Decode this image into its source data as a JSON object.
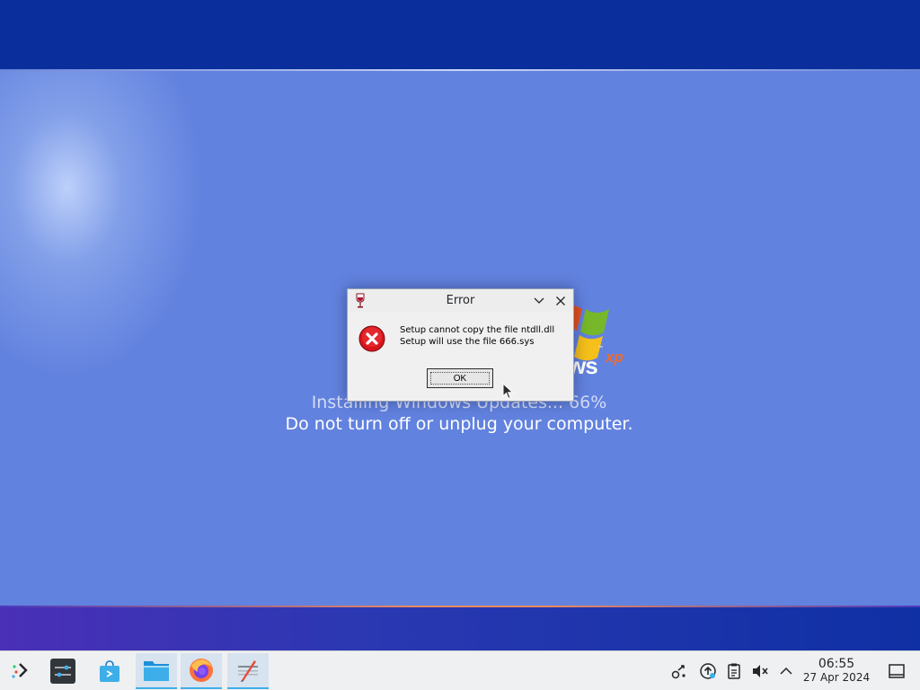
{
  "setup_screen": {
    "logo_word": "ws",
    "logo_sup": "xp",
    "logo_tm": "™",
    "progress_text": "Installing Windows Updates... 66%",
    "progress_percent": 66,
    "warning_text": "Do not turn off or unplug your computer."
  },
  "dialog": {
    "title": "Error",
    "message_line1": "Setup cannot copy the file ntdll.dll",
    "message_line2": "Setup will use the file 666.sys",
    "ok_label": "OK",
    "icon": "error-icon"
  },
  "taskbar": {
    "launchers": [
      {
        "name": "application-launcher",
        "icon": "kde-launcher-icon"
      },
      {
        "name": "system-settings",
        "icon": "settings-sliders-icon"
      },
      {
        "name": "discover",
        "icon": "store-bag-icon"
      },
      {
        "name": "file-manager",
        "icon": "folder-icon"
      },
      {
        "name": "firefox",
        "icon": "firefox-icon"
      },
      {
        "name": "wine-app",
        "icon": "pen-document-icon"
      }
    ],
    "tray": [
      "kde-connect-icon",
      "updates-icon",
      "clipboard-icon",
      "volume-muted-icon",
      "chevron-up-icon"
    ],
    "clock_time": "06:55",
    "clock_date": "27 Apr 2024",
    "accent": "#3daee9"
  }
}
